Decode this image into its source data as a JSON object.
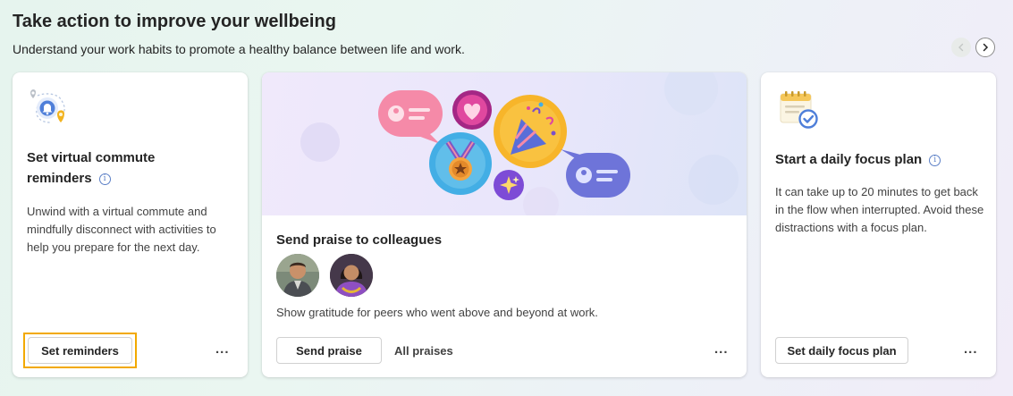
{
  "header": {
    "title": "Take action to improve your wellbeing",
    "subtitle": "Understand your work habits to promote a healthy balance between life and work."
  },
  "nav": {
    "prev_icon": "chevron-left-icon",
    "next_icon": "chevron-right-icon"
  },
  "cards": [
    {
      "title_line1": "Set virtual commute",
      "title_line2": "reminders",
      "description": "Unwind with a virtual commute and mindfully disconnect with activities to help you prepare for the next day.",
      "button": "Set reminders",
      "more": "...",
      "icon": "commute-location-icon"
    },
    {
      "title": "Send praise to colleagues",
      "description": "Show gratitude for peers who went above and beyond at work.",
      "button": "Send praise",
      "link": "All praises",
      "more": "...",
      "icon": "praise-illustration"
    },
    {
      "title": "Start a daily focus plan",
      "description": "It can take up to 20 minutes to get back in the flow when interrupted. Avoid these distractions with a focus plan.",
      "button": "Set daily focus plan",
      "more": "...",
      "icon": "calendar-check-icon"
    }
  ],
  "colors": {
    "focus_ring": "#f2a900",
    "accent": "#5b7fc6"
  }
}
